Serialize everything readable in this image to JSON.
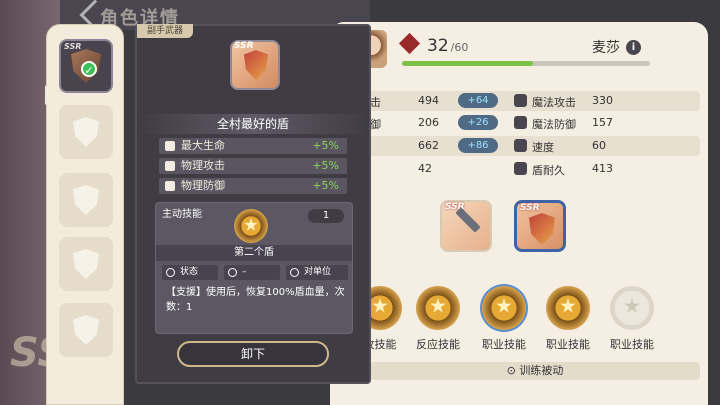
{
  "background": {
    "title": "角色详情"
  },
  "slots": {
    "tooltip_tag": "副手武器",
    "rarity": "SSR"
  },
  "popup": {
    "tag": "副手武器",
    "rarity": "SSR",
    "item_name": "全村最好的盾",
    "stats": [
      {
        "label": "最大生命",
        "value": "+5%"
      },
      {
        "label": "物理攻击",
        "value": "+5%"
      },
      {
        "label": "物理防御",
        "value": "+5%"
      }
    ],
    "skill": {
      "section_title": "主动技能",
      "count": "1",
      "name": "第二个盾",
      "tags": [
        {
          "label": "状态"
        },
        {
          "label": "–"
        },
        {
          "label": "对单位"
        }
      ],
      "description": "【支援】使用后，恢复100%盾血量，次数：1"
    },
    "unequip_button": "卸下"
  },
  "character": {
    "level": "32",
    "level_max": "/60",
    "level_progress": 0.53,
    "name": "麦莎",
    "info_icon": "i",
    "stats": [
      {
        "label1": "理攻击",
        "value1": "494",
        "bonus": "+64",
        "label2": "魔法攻击",
        "value2": "330"
      },
      {
        "label1": "理防御",
        "value1": "206",
        "bonus": "+26",
        "label2": "魔法防御",
        "value2": "157"
      },
      {
        "label1": "命",
        "value1": "662",
        "bonus": "+86",
        "label2": "速度",
        "value2": "60"
      },
      {
        "label1": "防御",
        "value1": "42",
        "bonus": "",
        "label2": "盾耐久",
        "value2": "413"
      }
    ],
    "equip_rarity": "SSR"
  },
  "skills": [
    {
      "label": "攻技能"
    },
    {
      "label": "反应技能"
    },
    {
      "label": "职业技能"
    },
    {
      "label": "职业技能"
    },
    {
      "label": "职业技能"
    }
  ],
  "train_button": "⊙ 训练被动",
  "colors": {
    "accent_green": "#86d35a",
    "bonus_blue": "#4e6a85",
    "panel_dark": "#3f3c44",
    "panel_light": "#f5efe3"
  }
}
